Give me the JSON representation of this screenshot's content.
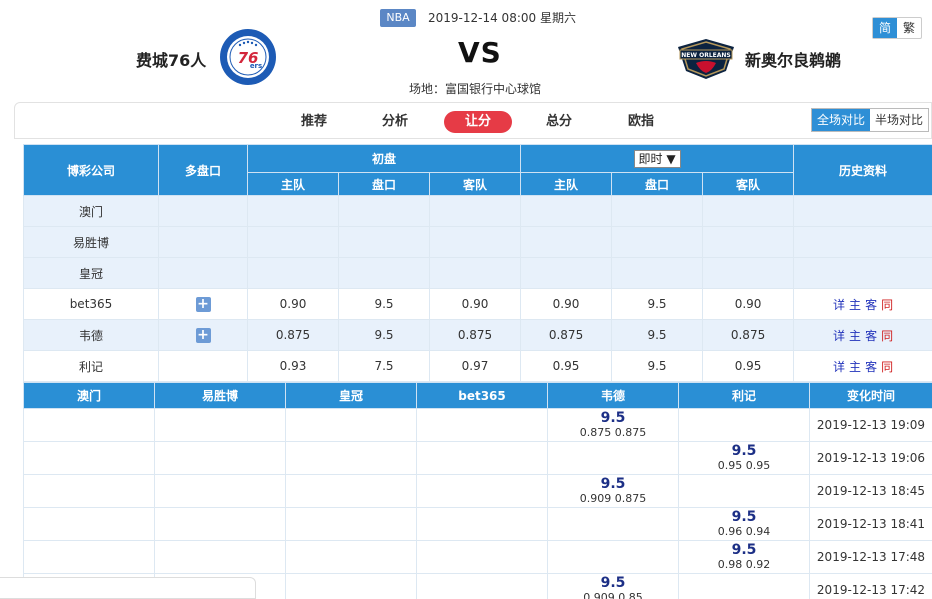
{
  "match": {
    "league": "NBA",
    "datetime": "2019-12-14 08:00 星期六",
    "home": "费城76人",
    "away": "新奥尔良鹈鹕",
    "vs": "VS",
    "venue": "场地：富国银行中心球馆"
  },
  "lang": {
    "simplified": "简",
    "traditional": "繁"
  },
  "nav": {
    "tabs": [
      "推荐",
      "分析",
      "让分",
      "总分",
      "欧指"
    ],
    "active": "让分"
  },
  "scope": {
    "full": "全场对比",
    "half": "半场对比"
  },
  "odds_table": {
    "headers": {
      "company": "博彩公司",
      "multi": "多盘口",
      "initial": "初盘",
      "live_select": "即时",
      "history": "历史资料",
      "home": "主队",
      "line": "盘口",
      "away": "客队"
    },
    "rows": [
      {
        "company": "澳门",
        "has_plus": false,
        "i_home": "",
        "i_line": "",
        "i_away": "",
        "l_home": "",
        "l_line": "",
        "l_away": "",
        "links": false
      },
      {
        "company": "易胜博",
        "has_plus": false,
        "i_home": "",
        "i_line": "",
        "i_away": "",
        "l_home": "",
        "l_line": "",
        "l_away": "",
        "links": false
      },
      {
        "company": "皇冠",
        "has_plus": false,
        "i_home": "",
        "i_line": "",
        "i_away": "",
        "l_home": "",
        "l_line": "",
        "l_away": "",
        "links": false
      },
      {
        "company": "bet365",
        "has_plus": true,
        "i_home": "0.90",
        "i_line": "9.5",
        "i_away": "0.90",
        "l_home": "0.90",
        "l_line": "9.5",
        "l_away": "0.90",
        "links": true
      },
      {
        "company": "韦德",
        "has_plus": true,
        "i_home": "0.875",
        "i_line": "9.5",
        "i_away": "0.875",
        "l_home": "0.875",
        "l_line": "9.5",
        "l_away": "0.875",
        "links": true
      },
      {
        "company": "利记",
        "has_plus": false,
        "i_home": "0.93",
        "i_line": "7.5",
        "i_away": "0.97",
        "l_home": "0.95",
        "l_line": "9.5",
        "l_away": "0.95",
        "links": true
      }
    ],
    "link_labels": [
      "详",
      "主",
      "客",
      "同"
    ],
    "plus_symbol": "+"
  },
  "history_table": {
    "headers": [
      "澳门",
      "易胜博",
      "皇冠",
      "bet365",
      "韦德",
      "利记",
      "变化时间"
    ],
    "rows": [
      {
        "col": 4,
        "line": "9.5",
        "odds": "0.875  0.875",
        "time": "2019-12-13 19:09"
      },
      {
        "col": 5,
        "line": "9.5",
        "odds": "0.95  0.95",
        "time": "2019-12-13 19:06"
      },
      {
        "col": 4,
        "line": "9.5",
        "odds": "0.909  0.875",
        "time": "2019-12-13 18:45"
      },
      {
        "col": 5,
        "line": "9.5",
        "odds": "0.96  0.94",
        "time": "2019-12-13 18:41"
      },
      {
        "col": 5,
        "line": "9.5",
        "odds": "0.98  0.92",
        "time": "2019-12-13 17:48"
      },
      {
        "col": 4,
        "line": "9.5",
        "odds": "0.909  0.85",
        "time": "2019-12-13 17:42"
      }
    ]
  },
  "colors": {
    "header_blue": "#2a8fd5",
    "active_tab_red": "#e63b46",
    "link_blue": "#2233bb",
    "link_red": "#d02020",
    "row_blue": "#e8f1fb"
  }
}
